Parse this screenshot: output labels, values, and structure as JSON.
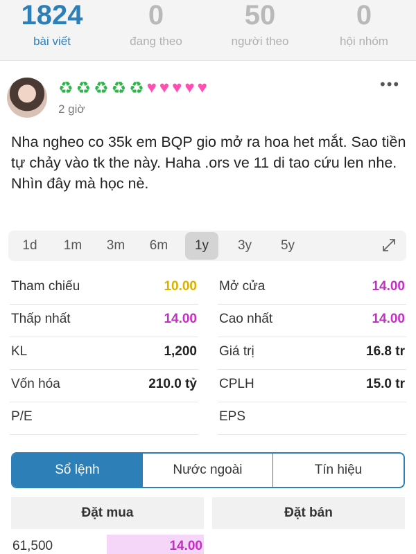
{
  "profile_stats": [
    {
      "value": "1824",
      "label": "bài viết"
    },
    {
      "value": "0",
      "label": "đang theo"
    },
    {
      "value": "50",
      "label": "người theo"
    },
    {
      "value": "0",
      "label": "hội nhóm"
    }
  ],
  "post": {
    "username_icons": [
      "recycle-icon",
      "recycle-icon",
      "recycle-icon",
      "recycle-icon",
      "recycle-icon",
      "sparkling-heart-icon",
      "sparkling-heart-icon",
      "sparkling-heart-icon",
      "sparkling-heart-icon",
      "sparkling-heart-icon"
    ],
    "time": "2 giờ",
    "more": "•••",
    "text": "Nha ngheo co 35k em BQP gio mở ra hoa het mắt. Sao tiền tự chảy vào tk the này. Haha .ors ve 11 di tao cứu len nhe. Nhìn đây mà học nè."
  },
  "ranges": {
    "items": [
      "1d",
      "1m",
      "3m",
      "6m",
      "1y",
      "3y",
      "5y"
    ],
    "selected": "1y"
  },
  "quote": {
    "rows": [
      {
        "left_label": "Tham chiếu",
        "left_value": "10.00",
        "right_label": "Mở cửa",
        "right_value": "14.00"
      },
      {
        "left_label": "Thấp nhất",
        "left_value": "14.00",
        "right_label": "Cao nhất",
        "right_value": "14.00"
      },
      {
        "left_label": "KL",
        "left_value": "1,200",
        "right_label": "Giá trị",
        "right_value": "16.8 tr"
      },
      {
        "left_label": "Vốn hóa",
        "left_value": "210.0 tỷ",
        "right_label": "CPLH",
        "right_value": "15.0 tr"
      },
      {
        "left_label": "P/E",
        "left_value": "",
        "right_label": "EPS",
        "right_value": ""
      }
    ]
  },
  "colors": {
    "accent": "#2d7fb8",
    "reference": "#d8b100",
    "ceiling": "#c42fc4"
  },
  "tabs": {
    "items": [
      "Sổ lệnh",
      "Nước ngoài",
      "Tín hiệu"
    ],
    "selected": "Sổ lệnh"
  },
  "order_book": {
    "buy_header": "Đặt mua",
    "sell_header": "Đặt bán",
    "buy_rows": [
      {
        "qty": "61,500",
        "price": "14.00"
      }
    ]
  }
}
